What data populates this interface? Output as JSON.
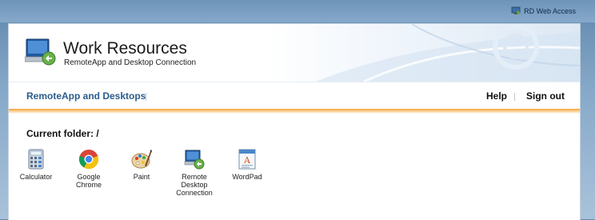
{
  "header_bar": {
    "rd_web_access": "RD Web Access"
  },
  "branding": {
    "title": "Work Resources",
    "subtitle": "RemoteApp and Desktop Connection"
  },
  "nav": {
    "remoteapp_desktops": "RemoteApp and Desktops",
    "help": "Help",
    "sign_out": "Sign out"
  },
  "folder": {
    "label": "Current folder: /"
  },
  "apps": [
    {
      "label": "Calculator",
      "icon": "calculator-icon"
    },
    {
      "label": "Google Chrome",
      "icon": "chrome-icon"
    },
    {
      "label": "Paint",
      "icon": "paint-icon"
    },
    {
      "label": "Remote Desktop Connection",
      "icon": "remote-desktop-icon"
    },
    {
      "label": "WordPad",
      "icon": "wordpad-icon"
    }
  ],
  "colors": {
    "accent_orange": "#f4a53a",
    "nav_link_blue": "#2b5c8c",
    "background_blue": "#86a8c8"
  }
}
